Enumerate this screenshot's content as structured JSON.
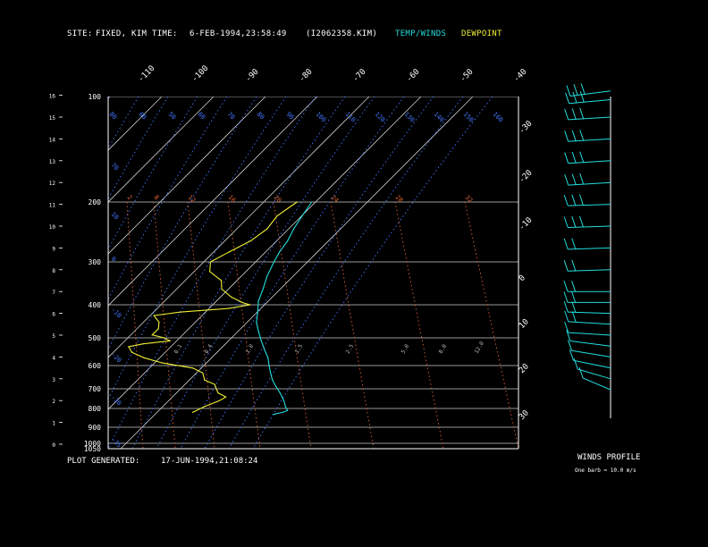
{
  "header": {
    "site_label": "SITE:",
    "site_value": "FIXED, KIM",
    "time_label": "TIME:",
    "time_value": "6-FEB-1994,23:58:49",
    "file_id": "(I2062358.KIM)",
    "legend_temp": "TEMP/WINDS",
    "legend_dew": "DEWPOINT"
  },
  "footer": {
    "plot_generated_label": "PLOT GENERATED:",
    "plot_generated_value": "17-JUN-1994,21:08:24",
    "winds_title": "WINDS PROFILE",
    "barb_note": "One barb = 10.0 m/s"
  },
  "colors": {
    "background": "#000000",
    "temp": "#22dddd",
    "dewpoint": "#eeee33",
    "isotherm": "#cccccc",
    "dry_adiabat": "#4477ff",
    "mixing_ratio": "#dd6633",
    "axis": "#ffffff"
  },
  "chart_data": {
    "type": "line",
    "subtype": "skew-T log-P sounding",
    "x_scale": "temperature (skewed)",
    "y_scale": "log pressure",
    "grid": true,
    "pressure_labels": [
      "100",
      "200",
      "300",
      "400",
      "500",
      "600",
      "700",
      "800",
      "900",
      "1000",
      "1050"
    ],
    "height_ticks": [
      "0",
      "1",
      "2",
      "3",
      "4",
      "5",
      "6",
      "7",
      "8",
      "9",
      "10",
      "11",
      "12",
      "13",
      "14",
      "15",
      "16"
    ],
    "top_temp_labels": [
      "-110",
      "-100",
      "-90",
      "-80",
      "-70",
      "-60",
      "-50",
      "-40"
    ],
    "right_temp_labels": [
      "-30",
      "-20",
      "-10",
      "0",
      "10",
      "20",
      "30"
    ],
    "mixing_ratio_labels": [
      "2",
      "8",
      "12",
      "16",
      "20",
      "24",
      "28",
      "32"
    ],
    "mixing_ratio_low_labels": [
      "0.1",
      "0.4",
      "1.0",
      "1.5",
      "2.5",
      "5.0",
      "8.0",
      "12.0"
    ],
    "adiabat_labels": [
      "80",
      "60",
      "50",
      "60",
      "70",
      "80",
      "90",
      "100",
      "110",
      "120",
      "130",
      "140",
      "150",
      "160"
    ],
    "adiabat_left_labels": [
      "70",
      "10",
      "0",
      "-10",
      "-20",
      "-30",
      "-35"
    ],
    "series": [
      {
        "name": "TEMP/WINDS",
        "points": [
          [
            200,
            -71
          ],
          [
            220,
            -69.5
          ],
          [
            240,
            -68
          ],
          [
            260,
            -66
          ],
          [
            280,
            -65
          ],
          [
            300,
            -63.5
          ],
          [
            330,
            -61
          ],
          [
            360,
            -58
          ],
          [
            390,
            -55.5
          ],
          [
            420,
            -52
          ],
          [
            450,
            -49
          ],
          [
            480,
            -45
          ],
          [
            510,
            -41
          ],
          [
            540,
            -37
          ],
          [
            570,
            -33
          ],
          [
            600,
            -30
          ],
          [
            630,
            -27
          ],
          [
            660,
            -24
          ],
          [
            690,
            -20.5
          ],
          [
            720,
            -17
          ],
          [
            760,
            -13
          ],
          [
            790,
            -10.5
          ],
          [
            810,
            -8.5
          ],
          [
            820,
            -9.5
          ],
          [
            830,
            -12
          ]
        ]
      },
      {
        "name": "DEWPOINT",
        "points": [
          [
            200,
            -76
          ],
          [
            220,
            -78
          ],
          [
            240,
            -77
          ],
          [
            260,
            -78.5
          ],
          [
            280,
            -82
          ],
          [
            300,
            -85
          ],
          [
            320,
            -82
          ],
          [
            340,
            -75
          ],
          [
            360,
            -72
          ],
          [
            380,
            -66
          ],
          [
            395,
            -60
          ],
          [
            400,
            -57
          ],
          [
            410,
            -63
          ],
          [
            420,
            -78
          ],
          [
            430,
            -86
          ],
          [
            450,
            -82
          ],
          [
            470,
            -80
          ],
          [
            490,
            -80
          ],
          [
            500,
            -75
          ],
          [
            510,
            -72
          ],
          [
            520,
            -80
          ],
          [
            530,
            -84
          ],
          [
            550,
            -81
          ],
          [
            570,
            -75
          ],
          [
            590,
            -67
          ],
          [
            610,
            -55
          ],
          [
            630,
            -50
          ],
          [
            660,
            -47
          ],
          [
            680,
            -42
          ],
          [
            700,
            -40
          ],
          [
            720,
            -38
          ],
          [
            740,
            -34
          ],
          [
            760,
            -35
          ],
          [
            790,
            -38
          ],
          [
            820,
            -40
          ]
        ]
      }
    ],
    "winds_profile": {
      "barb_unit_ms": 10.0,
      "levels_kft": [
        16.2,
        15.8,
        15.0,
        14.0,
        13.0,
        12.0,
        11.0,
        10.0,
        9.0,
        8.0,
        7.0,
        6.5,
        6.0,
        5.5,
        5.0,
        4.5,
        4.0,
        3.5,
        3.0,
        2.5
      ],
      "direction_deg": [
        250,
        255,
        260,
        260,
        260,
        260,
        265,
        265,
        265,
        265,
        270,
        270,
        275,
        280,
        280,
        290,
        295,
        300,
        310,
        320
      ],
      "speed_ms": [
        28,
        30,
        32,
        30,
        28,
        26,
        26,
        25,
        24,
        24,
        22,
        20,
        18,
        16,
        14,
        12,
        10,
        8,
        6,
        4
      ]
    }
  }
}
